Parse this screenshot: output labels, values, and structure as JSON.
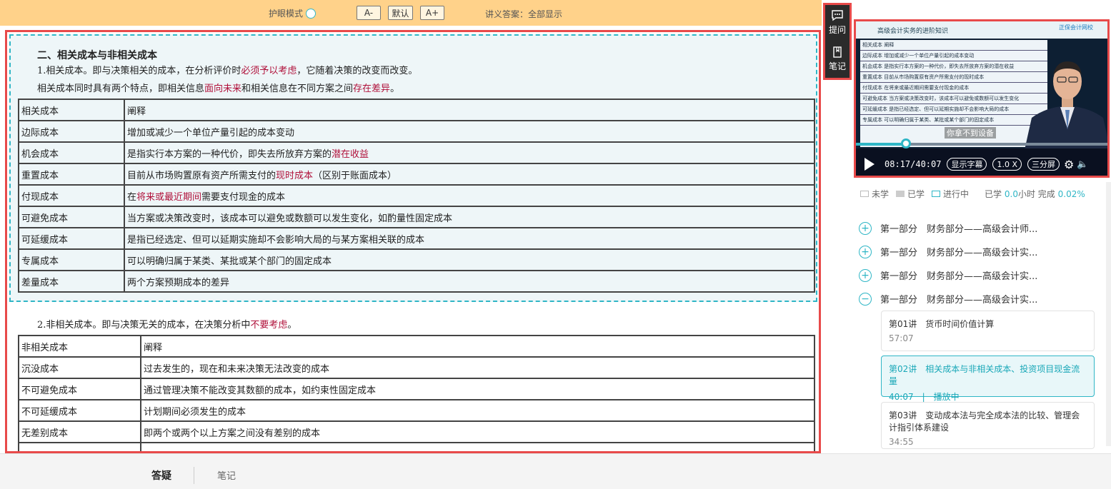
{
  "toolbar": {
    "eye_mode_label": "护眼模式",
    "font_decrease": "A-",
    "font_default": "默认",
    "font_increase": "A+",
    "answer_mode": "讲义答案：全部显示"
  },
  "side_icons": {
    "ask_label": "提问",
    "notes_label": "笔记"
  },
  "notes": {
    "section_title": "二、相关成本与非相关成本",
    "para1": {
      "pre": "1.相关成本。即与决策相关的成本，在分析评价时",
      "hl": "必须予以考虑",
      "post": "，它随着决策的改变而改变。"
    },
    "para2": {
      "pre": "相关成本同时具有两个特点，即相关信息",
      "hl1": "面向未来",
      "mid": "和相关信息在不同方案之间",
      "hl2": "存在差异",
      "post": "。"
    },
    "table1": {
      "header": [
        "相关成本",
        "阐释"
      ],
      "rows": [
        {
          "term": "边际成本",
          "pre": "增加或减少一个单位产量引起的成本变动",
          "hl": "",
          "post": ""
        },
        {
          "term": "机会成本",
          "pre": "是指实行本方案的一种代价，即失去所放弃方案的",
          "hl": "潜在收益",
          "post": ""
        },
        {
          "term": "重置成本",
          "pre": "目前从市场购置原有资产所需支付的",
          "hl": "现时成本",
          "post": "（区别于账面成本）"
        },
        {
          "term": "付现成本",
          "pre": "在",
          "hl": "将来或最近期间",
          "post": "需要支付现金的成本"
        },
        {
          "term": "可避免成本",
          "pre": "当方案或决策改变时，该成本可以避免或数额可以发生变化，如酌量性固定成本",
          "hl": "",
          "post": ""
        },
        {
          "term": "可延缓成本",
          "pre": "是指已经选定、但可以延期实施却不会影响大局的与某方案相关联的成本",
          "hl": "",
          "post": ""
        },
        {
          "term": "专属成本",
          "pre": "可以明确归属于某类、某批或某个部门的固定成本",
          "hl": "",
          "post": ""
        },
        {
          "term": "差量成本",
          "pre": "两个方案预期成本的差异",
          "hl": "",
          "post": ""
        }
      ]
    },
    "para3": {
      "pre": "2.非相关成本。即与决策无关的成本，在决策分析中",
      "hl": "不要考虑",
      "post": "。"
    },
    "table2": {
      "header": [
        "非相关成本",
        "阐释"
      ],
      "rows": [
        {
          "term": "沉没成本",
          "desc": "过去发生的，现在和未来决策无法改变的成本"
        },
        {
          "term": "不可避免成本",
          "desc": "通过管理决策不能改变其数额的成本，如约束性固定成本"
        },
        {
          "term": "不可延缓成本",
          "desc": "计划期间必须发生的成本"
        },
        {
          "term": "无差别成本",
          "desc": "即两个或两个以上方案之间没有差别的成本"
        }
      ]
    }
  },
  "video": {
    "header_title": "高级会计实务的进阶知识",
    "logo_text": "正保会计网校",
    "slide_rows": [
      "相关成本  阐释",
      "边际成本  增加或减少一个单位产量引起的成本变动",
      "机会成本  是指实行本方案的一种代价，即失去所放弃方案的潜在收益",
      "重置成本  目前从市场购置原有资产所需支付的现时成本",
      "付现成本  在将来或最近期间需要支付现金的成本",
      "可避免成本  当方案或决策改变时，该成本可以避免或数额可以发生变化",
      "可延缓成本  是指已经选定、但可以延期实施却不会影响大局的成本",
      "专属成本  可以明确归属于某类、某批或某个部门的固定成本"
    ],
    "subtitle": "你拿不到设备",
    "current_time": "08:17/40:07",
    "progress": 0.2,
    "subtitles_button": "显示字幕",
    "speed_button": "1.0 X",
    "layout_button": "三分屏"
  },
  "legend": {
    "not_studied": "未学",
    "studied": "已学",
    "in_progress": "进行中",
    "stats_pre": "已学",
    "hours": "0.0",
    "hours_unit": "小时 完成",
    "percent": "0.02%"
  },
  "chapters": [
    {
      "label": "第一部分　财务部分——高级会计师...",
      "icon": "plus"
    },
    {
      "label": "第一部分　财务部分——高级会计实...",
      "icon": "plus"
    },
    {
      "label": "第一部分　财务部分——高级会计实...",
      "icon": "plus"
    },
    {
      "label": "第一部分　财务部分——高级会计实...",
      "icon": "minus"
    }
  ],
  "lectures": [
    {
      "title": "第01讲　货币时间价值计算",
      "duration": "57:07",
      "status": ""
    },
    {
      "title": "第02讲　相关成本与非相关成本、投资项目现金流量",
      "duration": "40:07",
      "status": "播放中"
    },
    {
      "title": "第03讲　变动成本法与完全成本法的比较、管理会计指引体系建设",
      "duration": "34:55",
      "status": ""
    }
  ],
  "bottom": {
    "qa_tab": "答疑",
    "notes_tab": "笔记"
  }
}
